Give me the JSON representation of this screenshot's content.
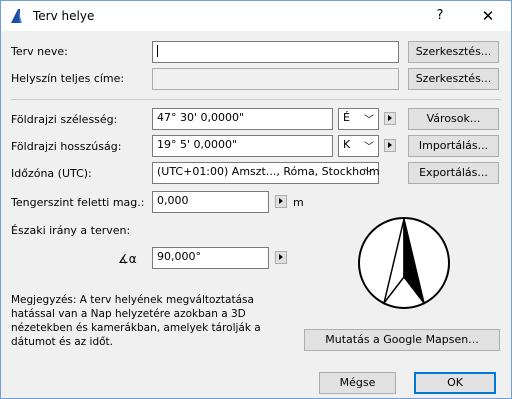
{
  "window": {
    "title": "Terv helye",
    "help_label": "?",
    "close_label": "✕"
  },
  "rows": {
    "project_name": {
      "label": "Terv neve:",
      "value": "",
      "button": "Szerkesztés..."
    },
    "full_address": {
      "label": "Helyszín teljes címe:",
      "value": "",
      "button": "Szerkesztés..."
    },
    "latitude": {
      "label": "Földrajzi szélesség:",
      "value": "47° 30' 0,0000\"",
      "hemisphere": "É",
      "button": "Városok..."
    },
    "longitude": {
      "label": "Földrajzi hosszúság:",
      "value": "19° 5' 0,0000\"",
      "hemisphere": "K",
      "button": "Importálás..."
    },
    "timezone": {
      "label": "Időzóna (UTC):",
      "value": "(UTC+01:00) Amszt..., Róma, Stockholm",
      "button": "Exportálás..."
    },
    "altitude": {
      "label": "Tengerszint feletti mag.:",
      "value": "0,000",
      "unit": "m"
    },
    "north": {
      "label": "Északi irány a terven:",
      "angle_symbol": "∡α",
      "value": "90,000°"
    }
  },
  "note": "Megjegyzés: A terv helyének megváltoztatása hatással van a Nap helyzetére azokban a 3D nézetekben és kamerákban, amelyek tárolják a dátumot és az időt.",
  "buttons": {
    "google_maps": "Mutatás a Google Mapsen...",
    "cancel": "Mégse",
    "ok": "OK"
  }
}
